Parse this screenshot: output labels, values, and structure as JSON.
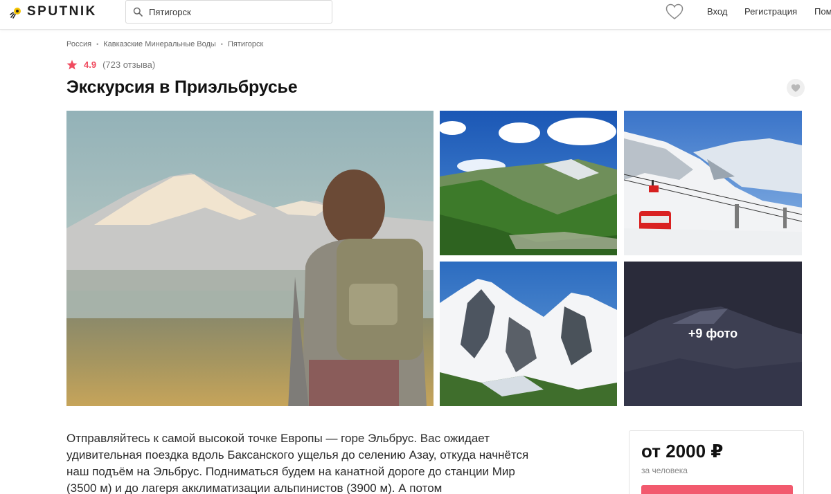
{
  "brand": {
    "name": "SPUTNIK"
  },
  "search": {
    "value": "Пятигорск",
    "placeholder": "Пятигорск"
  },
  "header": {
    "nav": [
      "Вход",
      "Регистрация",
      "Пом"
    ]
  },
  "breadcrumb": [
    "Россия",
    "Кавказские Минеральные Воды",
    "Пятигорск"
  ],
  "rating": {
    "value": "4.9",
    "count": "(723 отзыва)"
  },
  "title": "Экскурсия в Приэльбрусье",
  "gallery": {
    "more_label": "+9 фото"
  },
  "description": "Отправляйтесь к самой высокой точке Европы — горе Эльбрус. Вас ожидает удивительная поездка вдоль Баксанского ущелья до селению Азау, откуда начнётся наш подъём на Эльбрус. Подниматься будем на канатной дороге до станции Мир (3500 м) и до лагеря акклиматизации альпинистов (3900 м). А потом",
  "price_card": {
    "price": "от 2000 ₽",
    "per_person": "за человека",
    "book_label": ""
  },
  "colors": {
    "accent": "#f04b5f",
    "button": "#f25a6e",
    "logo_yellow": "#f5c400"
  },
  "icons": [
    "sputnik-logo-icon",
    "search-icon",
    "heart-icon",
    "star-icon",
    "favorite-heart-icon"
  ]
}
